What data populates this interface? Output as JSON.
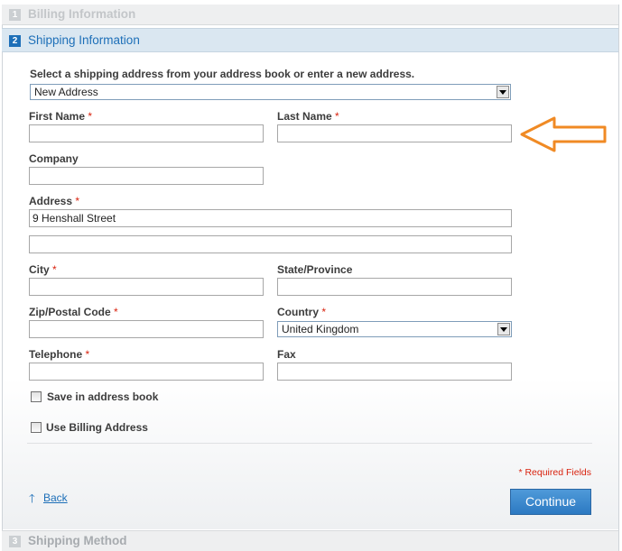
{
  "steps": [
    {
      "num": "1",
      "label": "Billing Information"
    },
    {
      "num": "2",
      "label": "Shipping Information"
    },
    {
      "num": "3",
      "label": "Shipping Method"
    }
  ],
  "form": {
    "intro": "Select a shipping address from your address book or enter a new address.",
    "address_select": "New Address",
    "first_name_label": "First Name",
    "last_name_label": "Last Name",
    "company_label": "Company",
    "address_label": "Address",
    "address_line1": "9 Henshall Street",
    "address_line2": "",
    "city_label": "City",
    "state_label": "State/Province",
    "zip_label": "Zip/Postal Code",
    "country_label": "Country",
    "country_value": "United Kingdom",
    "telephone_label": "Telephone",
    "fax_label": "Fax",
    "required_mark": "*",
    "save_label": "Save in address book",
    "billing_label": "Use Billing Address",
    "required_note": "* Required Fields",
    "back_arrow": "🡑",
    "back_label": "Back",
    "continue_label": "Continue"
  },
  "annotation": {
    "color": "#f08a24",
    "icon": "arrow-left-outline"
  }
}
